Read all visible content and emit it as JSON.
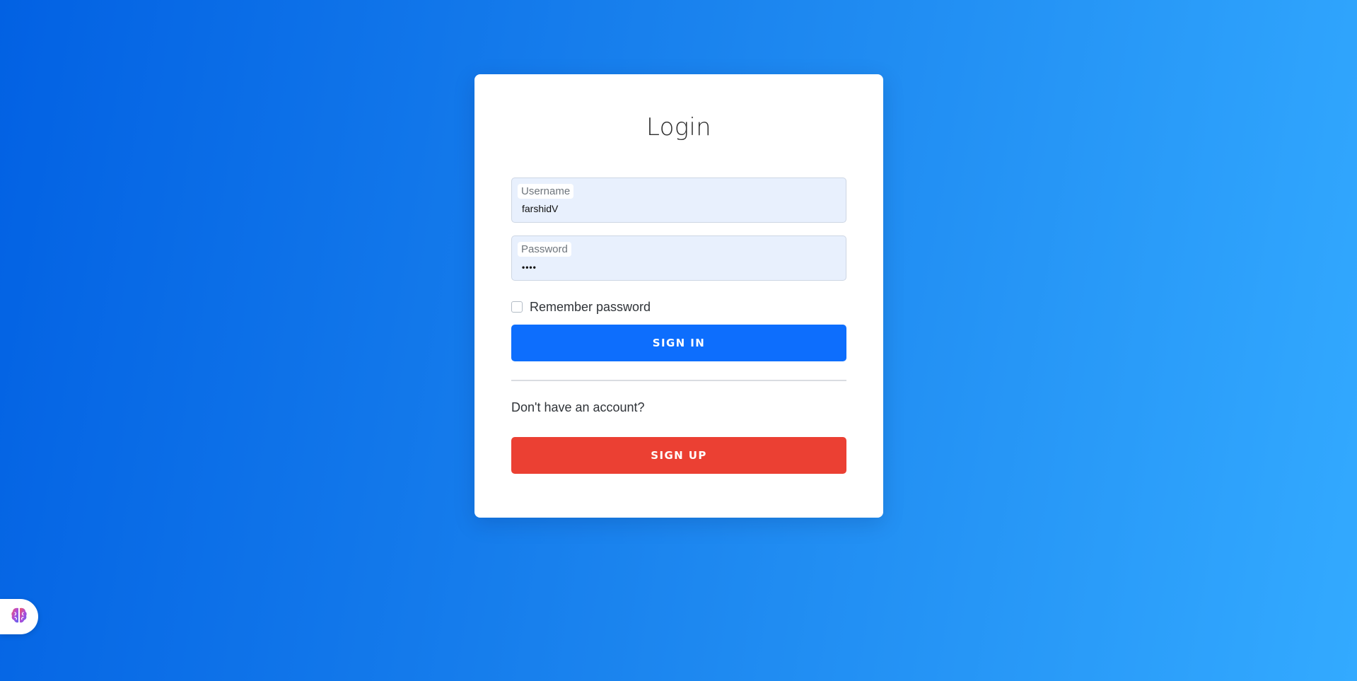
{
  "login": {
    "title": "Login",
    "username_label": "Username",
    "username_value": "farshidV",
    "password_label": "Password",
    "password_value": "••••",
    "remember_label": "Remember password",
    "signin_label": "SIGN IN",
    "account_text": "Don't have an account?",
    "signup_label": "SIGN UP"
  },
  "widget": {
    "icon": "brain-icon"
  },
  "colors": {
    "primary": "#0d6efd",
    "danger": "#eb4033",
    "field_bg": "#e8f0fd",
    "background_start": "#0261e3",
    "background_end": "#33aaff"
  }
}
